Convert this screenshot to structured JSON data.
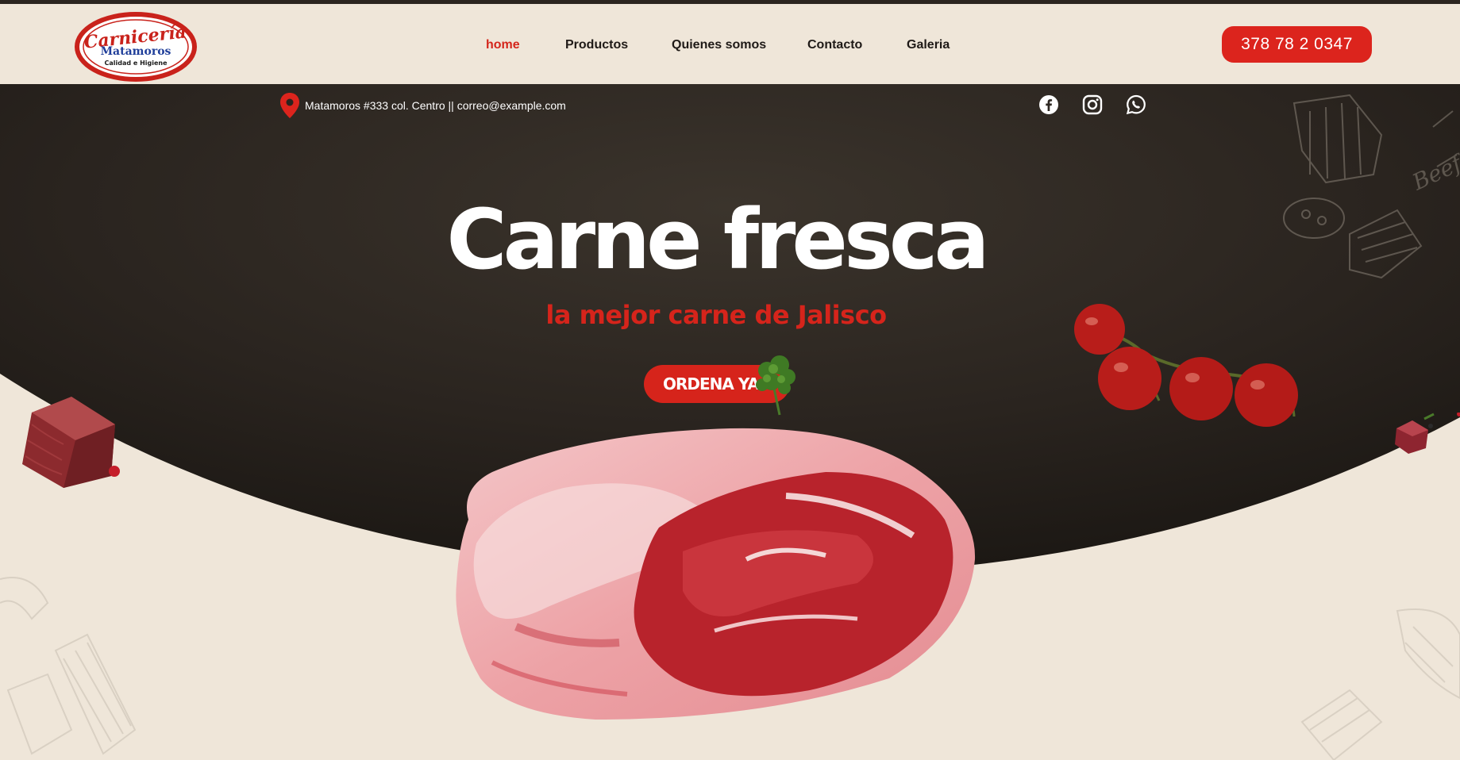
{
  "brand": {
    "logo_line1": "Carnicería",
    "logo_line2": "Matamoros",
    "logo_line3": "Calidad e Higiene"
  },
  "nav": {
    "items": [
      {
        "label": "home",
        "active": true
      },
      {
        "label": "Productos",
        "active": false
      },
      {
        "label": "Quienes somos",
        "active": false
      },
      {
        "label": "Contacto",
        "active": false
      },
      {
        "label": "Galeria",
        "active": false
      }
    ]
  },
  "header": {
    "phone_label": "378 78 2 0347"
  },
  "info_bar": {
    "address_text": "Matamoros #333 col. Centro || correo@example.com",
    "social_icons": [
      "facebook-icon",
      "instagram-icon",
      "whatsapp-icon"
    ]
  },
  "hero": {
    "headline": "Carne fresca",
    "subline": "la mejor carne de Jalisco",
    "cta_label": "ORDENA YA",
    "sketch_text": "Beef"
  },
  "colors": {
    "accent_red": "#dc241d",
    "cream_bg": "#efe6d9",
    "hero_dark": "#2a241f",
    "nav_active": "#d4261c"
  }
}
